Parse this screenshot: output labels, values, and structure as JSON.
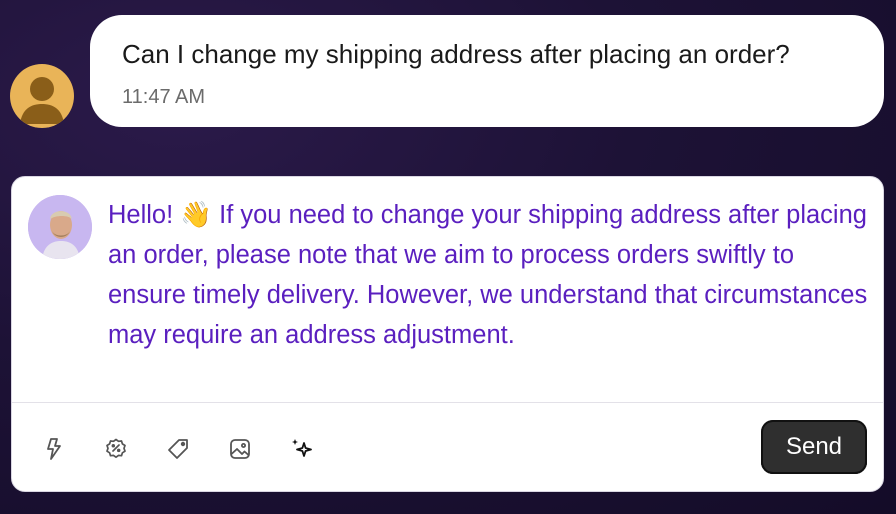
{
  "customer_message": {
    "text": "Can I change my shipping address after placing an order?",
    "timestamp": "11:47 AM"
  },
  "reply": {
    "text": "Hello! 👋 If you need to change your shipping address after placing an order, please note that we aim to process orders swiftly to ensure timely delivery. However, we understand that circumstances may require an address adjustment."
  },
  "toolbar": {
    "icons": [
      "lightning-icon",
      "discount-icon",
      "tag-icon",
      "image-icon",
      "sparkle-icon"
    ],
    "send_label": "Send"
  },
  "colors": {
    "reply_text": "#5a1fbf",
    "user_avatar": "#e9b458",
    "agent_avatar_bg": "#c8b7f0",
    "send_button": "#2f2f2f"
  }
}
